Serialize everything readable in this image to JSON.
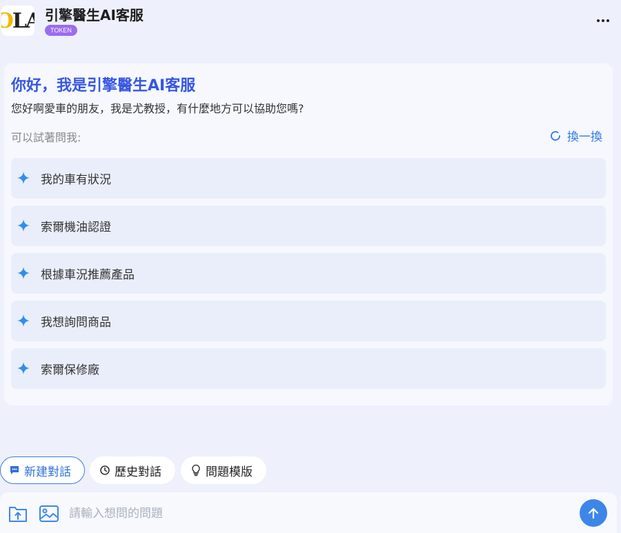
{
  "header": {
    "logo_text_o": "O",
    "logo_text_rest": "LA",
    "title": "引擎醫生AI客服",
    "badge": "TOKEN"
  },
  "welcome": {
    "title": "你好，我是引擎醫生AI客服",
    "subtitle": "您好啊愛車的朋友，我是尤教授，有什麼地方可以協助您嗎?",
    "hint": "可以試著問我:",
    "refresh_label": "換一換"
  },
  "suggestions": [
    {
      "label": "我的車有狀況"
    },
    {
      "label": "索爾機油認證"
    },
    {
      "label": "根據車況推薦產品"
    },
    {
      "label": "我想詢問商品"
    },
    {
      "label": "索爾保修廠"
    }
  ],
  "actions": {
    "new_chat": "新建對話",
    "history": "歷史對話",
    "templates": "問題模版"
  },
  "input": {
    "placeholder": "請輸入想問的問題",
    "value": ""
  },
  "colors": {
    "accent": "#3656e3",
    "link": "#2f7ae5",
    "badge": "#9b6cf0",
    "send": "#3d86e8",
    "sparkle": "#2f8fef"
  },
  "icons": {
    "more": "more-icon",
    "refresh": "refresh-icon",
    "sparkle": "sparkle-icon",
    "new_chat": "chat-bubble-icon",
    "history": "clock-icon",
    "templates": "lightbulb-icon",
    "upload_file": "folder-upload-icon",
    "upload_image": "image-icon",
    "send": "arrow-up-icon"
  }
}
